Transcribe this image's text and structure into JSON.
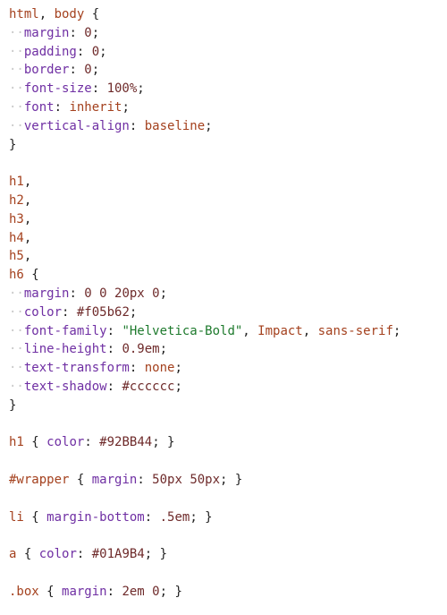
{
  "editor": {
    "lines": [
      [
        {
          "t": "html",
          "c": "sel"
        },
        {
          "t": ", ",
          "c": "punc"
        },
        {
          "t": "body",
          "c": "sel"
        },
        {
          "t": " {",
          "c": "punc"
        }
      ],
      [
        {
          "t": "··",
          "c": "dot"
        },
        {
          "t": "margin",
          "c": "prop"
        },
        {
          "t": ": ",
          "c": "punc"
        },
        {
          "t": "0",
          "c": "num"
        },
        {
          "t": ";",
          "c": "punc"
        }
      ],
      [
        {
          "t": "··",
          "c": "dot"
        },
        {
          "t": "padding",
          "c": "prop"
        },
        {
          "t": ": ",
          "c": "punc"
        },
        {
          "t": "0",
          "c": "num"
        },
        {
          "t": ";",
          "c": "punc"
        }
      ],
      [
        {
          "t": "··",
          "c": "dot"
        },
        {
          "t": "border",
          "c": "prop"
        },
        {
          "t": ": ",
          "c": "punc"
        },
        {
          "t": "0",
          "c": "num"
        },
        {
          "t": ";",
          "c": "punc"
        }
      ],
      [
        {
          "t": "··",
          "c": "dot"
        },
        {
          "t": "font-size",
          "c": "prop"
        },
        {
          "t": ": ",
          "c": "punc"
        },
        {
          "t": "100%",
          "c": "num"
        },
        {
          "t": ";",
          "c": "punc"
        }
      ],
      [
        {
          "t": "··",
          "c": "dot"
        },
        {
          "t": "font",
          "c": "prop"
        },
        {
          "t": ": ",
          "c": "punc"
        },
        {
          "t": "inherit",
          "c": "kw"
        },
        {
          "t": ";",
          "c": "punc"
        }
      ],
      [
        {
          "t": "··",
          "c": "dot"
        },
        {
          "t": "vertical-align",
          "c": "prop"
        },
        {
          "t": ": ",
          "c": "punc"
        },
        {
          "t": "baseline",
          "c": "kw"
        },
        {
          "t": ";",
          "c": "punc"
        }
      ],
      [
        {
          "t": "}",
          "c": "punc"
        }
      ],
      [],
      [
        {
          "t": "h1",
          "c": "sel"
        },
        {
          "t": ",",
          "c": "punc"
        }
      ],
      [
        {
          "t": "h2",
          "c": "sel"
        },
        {
          "t": ",",
          "c": "punc"
        }
      ],
      [
        {
          "t": "h3",
          "c": "sel"
        },
        {
          "t": ",",
          "c": "punc"
        }
      ],
      [
        {
          "t": "h4",
          "c": "sel"
        },
        {
          "t": ",",
          "c": "punc"
        }
      ],
      [
        {
          "t": "h5",
          "c": "sel"
        },
        {
          "t": ",",
          "c": "punc"
        }
      ],
      [
        {
          "t": "h6",
          "c": "sel"
        },
        {
          "t": " {",
          "c": "punc"
        }
      ],
      [
        {
          "t": "··",
          "c": "dot"
        },
        {
          "t": "margin",
          "c": "prop"
        },
        {
          "t": ": ",
          "c": "punc"
        },
        {
          "t": "0 0 20px 0",
          "c": "num"
        },
        {
          "t": ";",
          "c": "punc"
        }
      ],
      [
        {
          "t": "··",
          "c": "dot"
        },
        {
          "t": "color",
          "c": "prop"
        },
        {
          "t": ": ",
          "c": "punc"
        },
        {
          "t": "#f05b62",
          "c": "hex"
        },
        {
          "t": ";",
          "c": "punc"
        }
      ],
      [
        {
          "t": "··",
          "c": "dot"
        },
        {
          "t": "font-family",
          "c": "prop"
        },
        {
          "t": ": ",
          "c": "punc"
        },
        {
          "t": "\"Helvetica-Bold\"",
          "c": "str"
        },
        {
          "t": ", ",
          "c": "punc"
        },
        {
          "t": "Impact",
          "c": "kw"
        },
        {
          "t": ", ",
          "c": "punc"
        },
        {
          "t": "sans-serif",
          "c": "kw"
        },
        {
          "t": ";",
          "c": "punc"
        }
      ],
      [
        {
          "t": "··",
          "c": "dot"
        },
        {
          "t": "line-height",
          "c": "prop"
        },
        {
          "t": ": ",
          "c": "punc"
        },
        {
          "t": "0.9em",
          "c": "num"
        },
        {
          "t": ";",
          "c": "punc"
        }
      ],
      [
        {
          "t": "··",
          "c": "dot"
        },
        {
          "t": "text-transform",
          "c": "prop"
        },
        {
          "t": ": ",
          "c": "punc"
        },
        {
          "t": "none",
          "c": "kw"
        },
        {
          "t": ";",
          "c": "punc"
        }
      ],
      [
        {
          "t": "··",
          "c": "dot"
        },
        {
          "t": "text-shadow",
          "c": "prop"
        },
        {
          "t": ": ",
          "c": "punc"
        },
        {
          "t": "#cccccc",
          "c": "hex"
        },
        {
          "t": ";",
          "c": "punc"
        }
      ],
      [
        {
          "t": "}",
          "c": "punc"
        }
      ],
      [],
      [
        {
          "t": "h1",
          "c": "sel"
        },
        {
          "t": " { ",
          "c": "punc"
        },
        {
          "t": "color",
          "c": "prop"
        },
        {
          "t": ": ",
          "c": "punc"
        },
        {
          "t": "#92BB44",
          "c": "hex"
        },
        {
          "t": "; }",
          "c": "punc"
        }
      ],
      [],
      [
        {
          "t": "#wrapper",
          "c": "sel"
        },
        {
          "t": " { ",
          "c": "punc"
        },
        {
          "t": "margin",
          "c": "prop"
        },
        {
          "t": ": ",
          "c": "punc"
        },
        {
          "t": "50px 50px",
          "c": "num"
        },
        {
          "t": "; }",
          "c": "punc"
        }
      ],
      [],
      [
        {
          "t": "li",
          "c": "sel"
        },
        {
          "t": " { ",
          "c": "punc"
        },
        {
          "t": "margin-bottom",
          "c": "prop"
        },
        {
          "t": ": ",
          "c": "punc"
        },
        {
          "t": ".5em",
          "c": "num"
        },
        {
          "t": "; }",
          "c": "punc"
        }
      ],
      [],
      [
        {
          "t": "a",
          "c": "sel"
        },
        {
          "t": " { ",
          "c": "punc"
        },
        {
          "t": "color",
          "c": "prop"
        },
        {
          "t": ": ",
          "c": "punc"
        },
        {
          "t": "#01A9B4",
          "c": "hex"
        },
        {
          "t": "; }",
          "c": "punc"
        }
      ],
      [],
      [
        {
          "t": ".box",
          "c": "sel"
        },
        {
          "t": " { ",
          "c": "punc"
        },
        {
          "t": "margin",
          "c": "prop"
        },
        {
          "t": ": ",
          "c": "punc"
        },
        {
          "t": "2em 0",
          "c": "num"
        },
        {
          "t": "; }",
          "c": "punc"
        }
      ]
    ]
  }
}
